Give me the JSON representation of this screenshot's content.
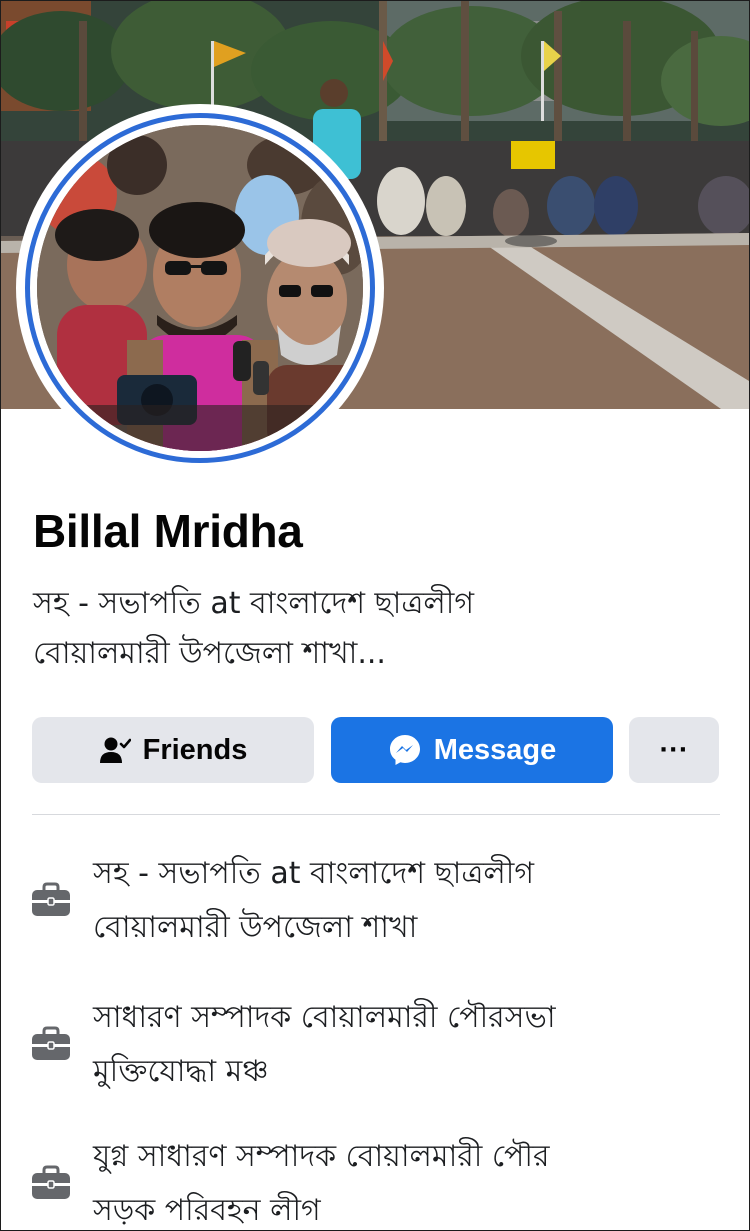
{
  "profile": {
    "name": "Billal Mridha",
    "bio_line1": "সহ - সভাপতি at বাংলাদেশ ছাত্রলীগ",
    "bio_line2": "বোয়ালমারী উপজেলা শাখা..."
  },
  "actions": {
    "friends_label": "Friends",
    "message_label": "Message",
    "more_label": "···"
  },
  "work": [
    {
      "line1": "সহ - সভাপতি at বাংলাদেশ ছাত্রলীগ",
      "line2": "বোয়ালমারী উপজেলা শাখা",
      "icon": "briefcase-icon"
    },
    {
      "line1": "সাধারণ সম্পাদক বোয়ালমারী পৌরসভা",
      "line2": "মুক্তিযোদ্ধা মঞ্চ",
      "icon": "briefcase-icon"
    },
    {
      "line1": "যুগ্ন সাধারণ সম্পাদক বোয়ালমারী পৌর",
      "line2": "সড়ক পরিবহন লীগ",
      "icon": "briefcase-icon"
    }
  ],
  "colors": {
    "accent": "#1b74e4",
    "story_ring": "#2d6bd6",
    "button_gray": "#e4e6eb",
    "icon_gray": "#65676b"
  }
}
